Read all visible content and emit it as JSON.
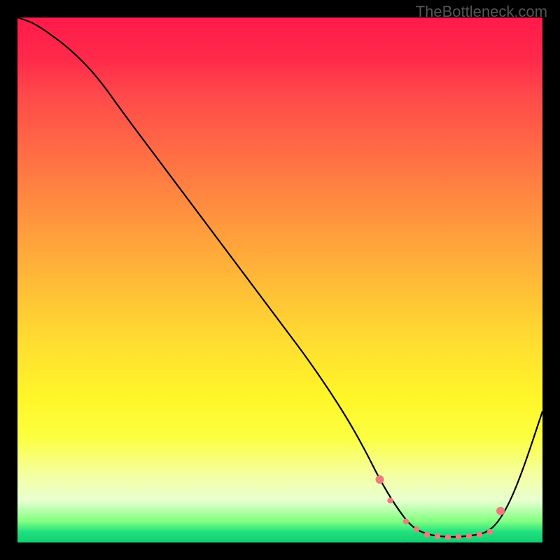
{
  "watermark": "TheBottleneck.com",
  "chart_data": {
    "type": "line",
    "title": "",
    "xlabel": "",
    "ylabel": "",
    "xlim": [
      0,
      100
    ],
    "ylim": [
      0,
      100
    ],
    "series": [
      {
        "name": "bottleneck-curve",
        "x": [
          0,
          3,
          6,
          10,
          15,
          20,
          26,
          32,
          38,
          44,
          50,
          56,
          62,
          66,
          69,
          72,
          75,
          78,
          82,
          86,
          90,
          93,
          96,
          100
        ],
        "values": [
          100,
          99,
          97,
          94,
          89,
          82,
          74,
          66,
          58,
          50,
          42,
          34,
          25,
          18,
          12,
          7,
          3,
          1.5,
          1,
          1.2,
          2,
          6,
          13,
          25
        ]
      }
    ],
    "highlight_points": {
      "name": "optimal-range-markers",
      "color": "#ef7b7e",
      "x": [
        69,
        71,
        74,
        76,
        78,
        80,
        82,
        84,
        86,
        88,
        90,
        92
      ],
      "y": [
        12,
        8,
        4,
        2.5,
        1.5,
        1.2,
        1,
        1.1,
        1.2,
        1.5,
        2,
        6
      ]
    },
    "gradient_meaning": "vertical color gradient from red (high bottleneck) at top to green (no bottleneck) at bottom"
  }
}
